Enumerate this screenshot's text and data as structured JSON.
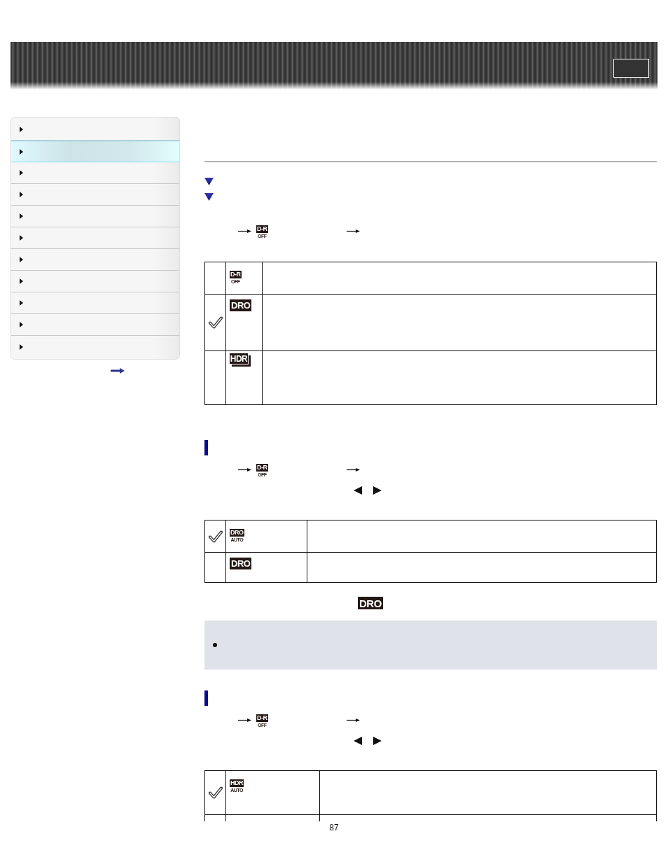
{
  "sidebar": {
    "items": [
      {
        "selected": false
      },
      {
        "selected": true
      },
      {
        "selected": false
      },
      {
        "selected": false
      },
      {
        "selected": false
      },
      {
        "selected": false
      },
      {
        "selected": false
      },
      {
        "selected": false
      },
      {
        "selected": false
      },
      {
        "selected": false
      },
      {
        "selected": false
      }
    ]
  },
  "intro": {
    "menu_path": {
      "badge": {
        "kind": "stacked",
        "top": "D-R",
        "bottom": "OFF"
      }
    },
    "table": {
      "rows": [
        {
          "checked": false,
          "badge": {
            "kind": "stacked",
            "top": "D-R",
            "bottom": "OFF"
          }
        },
        {
          "checked": true,
          "badge": {
            "kind": "solid",
            "text": "DRO"
          }
        },
        {
          "checked": false,
          "badge": {
            "kind": "shadow",
            "text": "HDR"
          }
        }
      ]
    }
  },
  "sections": [
    {
      "menu_path": {
        "badge": {
          "kind": "stacked",
          "top": "D-R",
          "bottom": "OFF"
        }
      },
      "table": {
        "rows": [
          {
            "checked": true,
            "badge": {
              "kind": "stacked",
              "top": "DRO",
              "bottom": "AUTO"
            }
          },
          {
            "checked": false,
            "badge": {
              "kind": "solid",
              "text": "DRO"
            }
          }
        ]
      },
      "indicator": {
        "badge": {
          "kind": "solid",
          "text": "DRO"
        }
      },
      "note": true
    },
    {
      "menu_path": {
        "badge": {
          "kind": "stacked",
          "top": "D-R",
          "bottom": "OFF"
        }
      },
      "table": {
        "rows": [
          {
            "checked": true,
            "badge": {
              "kind": "stacked",
              "top": "HDR",
              "bottom": "AUTO"
            }
          }
        ],
        "continues": true
      }
    }
  ],
  "page_number": "87"
}
